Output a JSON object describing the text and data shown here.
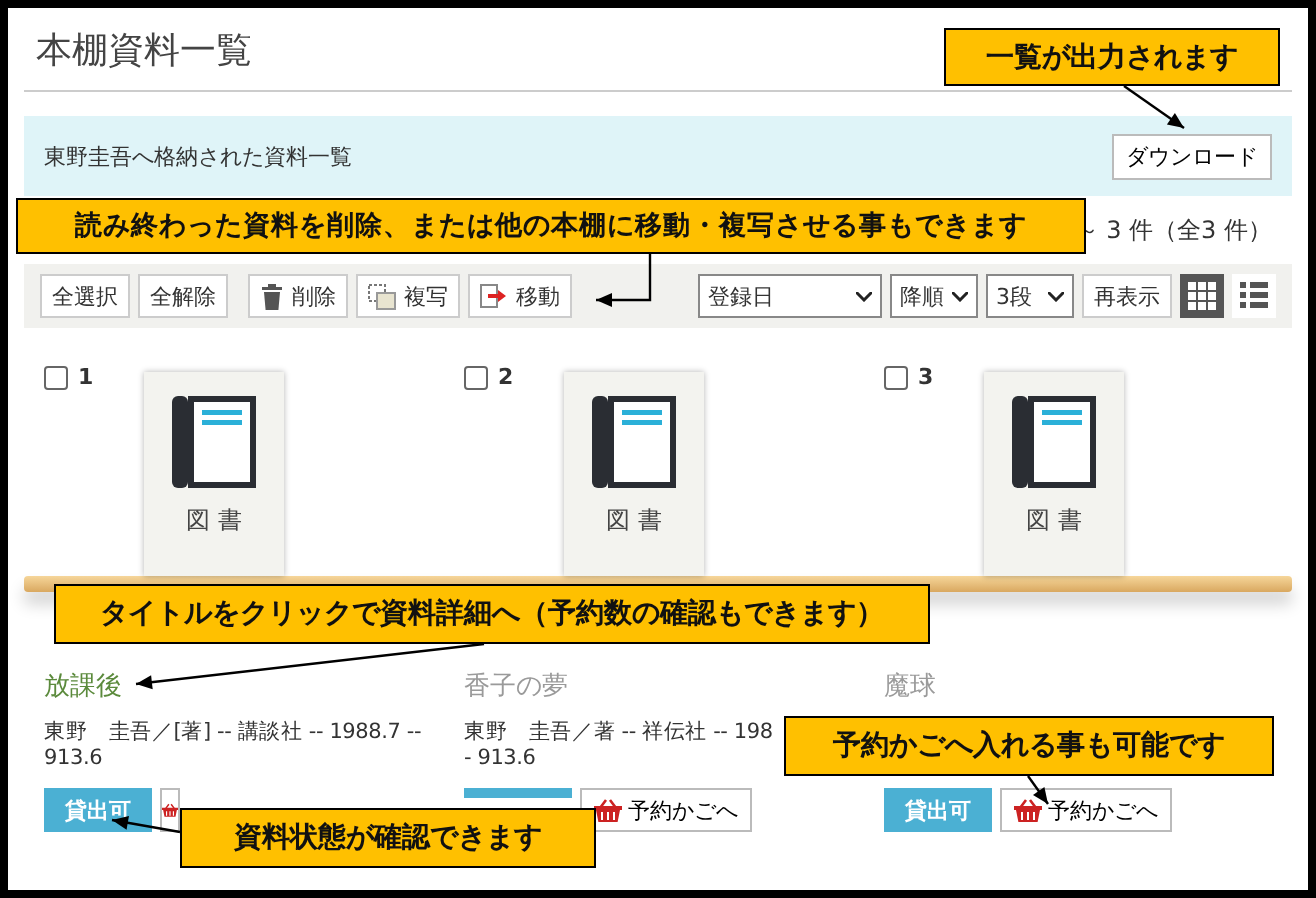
{
  "page_title": "本棚資料一覧",
  "banner": {
    "text": "東野圭吾へ格納された資料一覧",
    "download_button": "ダウンロード"
  },
  "count": "～ 3 件（全3 件）",
  "toolbar": {
    "buttons": [
      {
        "label": "全選択",
        "kind": "plain"
      },
      {
        "label": "全解除",
        "kind": "plain"
      },
      {
        "label": "削除",
        "kind": "delete"
      },
      {
        "label": "複写",
        "kind": "copy"
      },
      {
        "label": "移動",
        "kind": "move"
      }
    ],
    "selects": [
      {
        "value": "登録日",
        "kind": "wide"
      },
      {
        "value": "降順",
        "kind": "narrow"
      },
      {
        "value": "3段",
        "kind": "narrow"
      }
    ],
    "refresh_button": "再表示",
    "views": [
      {
        "kind": "grid",
        "selected": true
      },
      {
        "kind": "list",
        "selected": false
      }
    ]
  },
  "items": [
    {
      "number": "1",
      "checked": false,
      "cover_label": "図 書",
      "title": "放課後",
      "color": "#5b8a3c",
      "meta": "東野　圭吾／[著] -- 講談社 -- 1988.7 -- 913.6",
      "status": "貸出可"
    },
    {
      "number": "2",
      "checked": false,
      "cover_label": "図 書",
      "title": "香子の夢",
      "color": "#9a9a9a",
      "meta": "東野　圭吾／著 -- 祥伝社 -- 198",
      "meta_2": "- 913.6",
      "basket": "予約かごへ"
    },
    {
      "number": "3",
      "checked": false,
      "cover_label": "図 書",
      "title": "魔球",
      "color": "#9a9a9a",
      "status": "貸出可",
      "basket": "予約かごへ"
    }
  ],
  "callouts": [
    {
      "text": "一覧が出力されます"
    },
    {
      "text": "読み終わった資料を削除、または他の本棚に移動・複写させる事もできます"
    },
    {
      "text": "タイトルをクリックで資料詳細へ（予約数の確認もできます）"
    },
    {
      "text": "予約かごへ入れる事も可能です"
    },
    {
      "text": "資料状態が確認できます"
    }
  ]
}
